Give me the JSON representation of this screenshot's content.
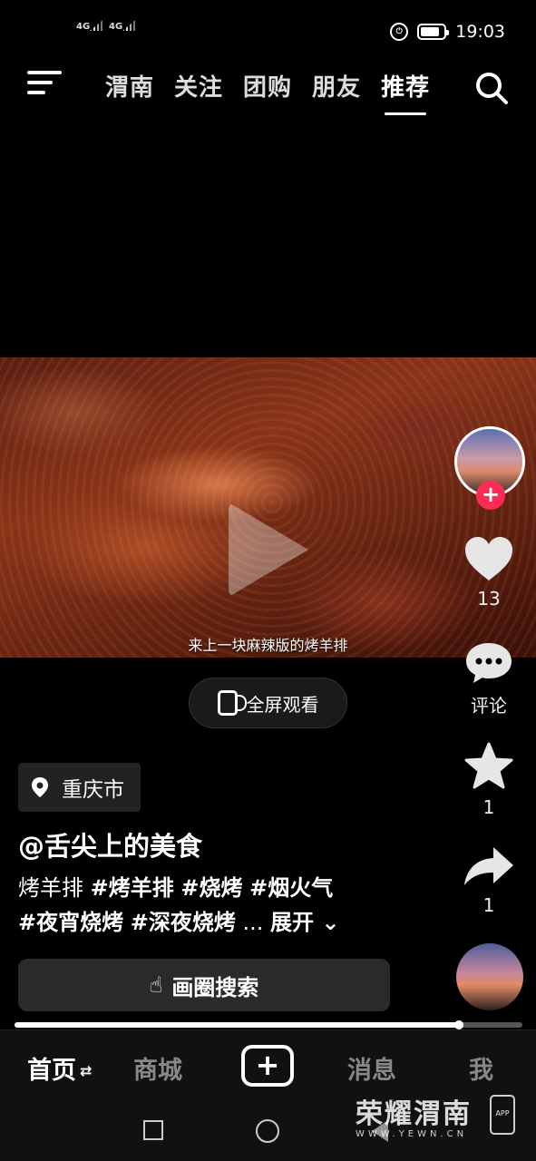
{
  "status_bar": {
    "sim1": "4G",
    "sim2": "4G",
    "time": "19:03"
  },
  "top_nav": {
    "tabs": [
      {
        "label": "渭南"
      },
      {
        "label": "关注"
      },
      {
        "label": "团购"
      },
      {
        "label": "朋友"
      },
      {
        "label": "推荐"
      }
    ],
    "active_tab": "推荐"
  },
  "video": {
    "subtitle": "来上一块麻辣版的烤羊排",
    "fullscreen_label": "全屏观看"
  },
  "actions": {
    "likes": "13",
    "comments_label": "评论",
    "favorites": "1",
    "shares": "1"
  },
  "post": {
    "location": "重庆市",
    "author": "@舌尖上的美食",
    "title": "烤羊排",
    "tags_line1": [
      "#烤羊排",
      "#烧烤",
      "#烟火气"
    ],
    "tags_line2": [
      "#夜宵烧烤",
      "#深夜烧烤"
    ],
    "ellipsis": "...",
    "expand_label": "展开"
  },
  "circle_search_label": "画圈搜索",
  "progress": 0.875,
  "bottom_nav": {
    "home": "首页",
    "mall": "商城",
    "add": "+",
    "messages": "消息",
    "me": "我"
  },
  "watermark": {
    "main": "荣耀渭南",
    "sub": "WWW.YEWN.CN",
    "app": "APP"
  },
  "colors": {
    "accent": "#fe2c55",
    "background": "#000000"
  }
}
